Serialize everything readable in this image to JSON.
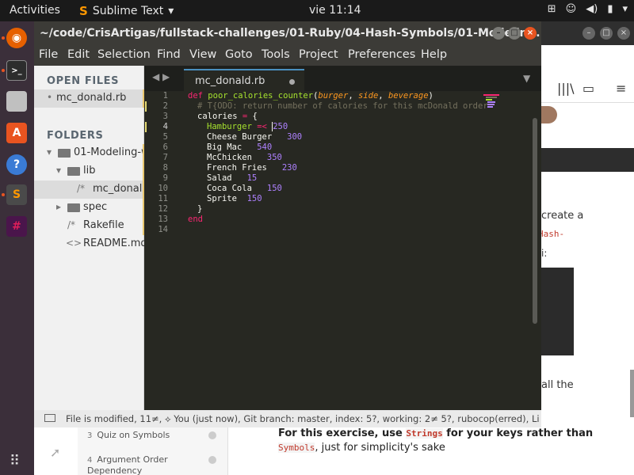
{
  "topbar": {
    "activities": "Activities",
    "app_name": "Sublime Text",
    "app_menu_arrow": "▾",
    "clock": "vie 11:14",
    "tray_icons": [
      "network-icon",
      "accessibility-icon",
      "volume-icon",
      "battery-icon",
      "power-menu-icon"
    ]
  },
  "dock": {
    "apps": [
      "firefox-icon",
      "terminal-icon",
      "file-manager-icon",
      "software-center-icon",
      "help-icon",
      "sublime-text-icon",
      "slack-icon"
    ],
    "show_apps": "show-apps-icon"
  },
  "window": {
    "title": "~/code/CrisArtigas/fullstack-challenges/01-Ruby/04-Hash-Symbols/01-Modelin...",
    "controls": [
      "minimize",
      "maximize",
      "close"
    ]
  },
  "menubar": [
    "File",
    "Edit",
    "Selection",
    "Find",
    "View",
    "Goto",
    "Tools",
    "Project",
    "Preferences",
    "Help"
  ],
  "sidebar": {
    "open_files_header": "OPEN FILES",
    "open_files": [
      "mc_donald.rb"
    ],
    "folders_header": "FOLDERS",
    "tree": [
      {
        "label": "01-Modeling-w",
        "icon": "▾",
        "kind": "folder"
      },
      {
        "label": "lib",
        "icon": "▾",
        "kind": "folder"
      },
      {
        "label": "mc_donald",
        "icon": "/*",
        "kind": "file"
      },
      {
        "label": "spec",
        "icon": "▸",
        "kind": "folder"
      },
      {
        "label": "Rakefile",
        "icon": "/*",
        "kind": "file"
      },
      {
        "label": "README.md",
        "icon": "<>",
        "kind": "file"
      }
    ]
  },
  "editor": {
    "tab_label": "mc_donald.rb",
    "nav_arrows": "◀ ▶",
    "tab_dropdown": "▼",
    "active_line": 4,
    "line_numbers": [
      "1",
      "2",
      "3",
      "4",
      "5",
      "6",
      "7",
      "8",
      "9",
      "10",
      "11",
      "12",
      "13",
      "14"
    ],
    "code": {
      "l1": {
        "kw": "def",
        "fn": "poor_calories_counter",
        "open": "(",
        "p1": "burger",
        "c1": ", ",
        "p2": "side",
        "c2": ", ",
        "p3": "beverage",
        "close": ")"
      },
      "l2": {
        "comment": "# T{ODO: return number of calories for this mcDonald order"
      },
      "l3": {
        "var": "calories",
        "op": " = ",
        "brace": "{"
      },
      "l4": {
        "key": "Hamburger",
        "op": " =< ",
        "num": "250"
      },
      "items": [
        {
          "key": "Cheese Burger",
          "num": "300"
        },
        {
          "key": "Big Mac",
          "num": "540"
        },
        {
          "key": "McChicken",
          "num": "350"
        },
        {
          "key": "French Fries",
          "num": "230"
        },
        {
          "key": "Salad",
          "num": "15"
        },
        {
          "key": "Coca Cola",
          "num": "150"
        },
        {
          "key": "Sprite",
          "num": "150"
        }
      ],
      "l12": "}",
      "l13": "end"
    }
  },
  "status": {
    "text": "File is modified, 11≠, ⟡ You (just now), Git branch: master, index: 5?, working: 2≠ 5?, rubocop(erred), Li"
  },
  "background_browser": {
    "text_create": "create a",
    "text_hash": "Hash-",
    "text_colon": "i:",
    "text_all": "all the",
    "lessons": [
      {
        "num": "3",
        "label": "Quiz on Symbols"
      },
      {
        "num": "4",
        "label": "Argument Order Dependency"
      }
    ],
    "hint_prefix": "For this exercise, use ",
    "hint_code1": "Strings",
    "hint_mid": " for your keys rather than",
    "hint_code2": "Symbols",
    "hint_suffix": ", just for simplicity's sake"
  },
  "colors": {
    "keyword": "#f92672",
    "function": "#a6e22e",
    "param": "#fd971f",
    "number": "#ae81ff",
    "comment": "#75715e",
    "editor_bg": "#272822",
    "accent": "#e95420"
  }
}
